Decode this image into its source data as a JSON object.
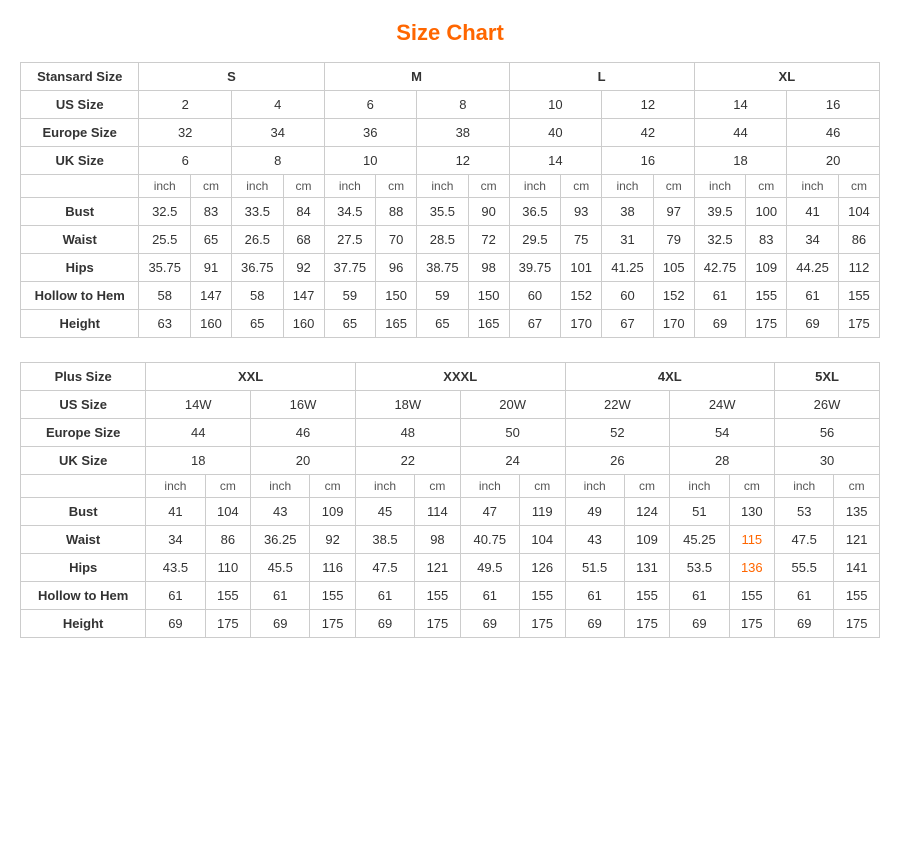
{
  "title": "Size Chart",
  "standard": {
    "headers": {
      "col1": "Stansard Size",
      "s": "S",
      "m": "M",
      "l": "L",
      "xl": "XL"
    },
    "us_size": {
      "label": "US Size",
      "values": [
        "2",
        "4",
        "6",
        "8",
        "10",
        "12",
        "14",
        "16"
      ]
    },
    "europe_size": {
      "label": "Europe Size",
      "values": [
        "32",
        "34",
        "36",
        "38",
        "40",
        "42",
        "44",
        "46"
      ]
    },
    "uk_size": {
      "label": "UK Size",
      "values": [
        "6",
        "8",
        "10",
        "12",
        "14",
        "16",
        "18",
        "20"
      ]
    },
    "subheader": [
      "inch",
      "cm",
      "inch",
      "cm",
      "inch",
      "cm",
      "inch",
      "cm",
      "inch",
      "cm",
      "inch",
      "cm",
      "inch",
      "cm",
      "inch",
      "cm"
    ],
    "bust": {
      "label": "Bust",
      "values": [
        "32.5",
        "83",
        "33.5",
        "84",
        "34.5",
        "88",
        "35.5",
        "90",
        "36.5",
        "93",
        "38",
        "97",
        "39.5",
        "100",
        "41",
        "104"
      ]
    },
    "waist": {
      "label": "Waist",
      "values": [
        "25.5",
        "65",
        "26.5",
        "68",
        "27.5",
        "70",
        "28.5",
        "72",
        "29.5",
        "75",
        "31",
        "79",
        "32.5",
        "83",
        "34",
        "86"
      ]
    },
    "hips": {
      "label": "Hips",
      "values": [
        "35.75",
        "91",
        "36.75",
        "92",
        "37.75",
        "96",
        "38.75",
        "98",
        "39.75",
        "101",
        "41.25",
        "105",
        "42.75",
        "109",
        "44.25",
        "112"
      ]
    },
    "hollow": {
      "label": "Hollow to Hem",
      "values": [
        "58",
        "147",
        "58",
        "147",
        "59",
        "150",
        "59",
        "150",
        "60",
        "152",
        "60",
        "152",
        "61",
        "155",
        "61",
        "155"
      ]
    },
    "height": {
      "label": "Height",
      "values": [
        "63",
        "160",
        "65",
        "160",
        "65",
        "165",
        "65",
        "165",
        "67",
        "170",
        "67",
        "170",
        "69",
        "175",
        "69",
        "175"
      ]
    }
  },
  "plus": {
    "headers": {
      "col1": "Plus Size",
      "xxl": "XXL",
      "xxxl": "XXXL",
      "x4l": "4XL",
      "x5l": "5XL"
    },
    "us_size": {
      "label": "US Size",
      "values": [
        "14W",
        "16W",
        "18W",
        "20W",
        "22W",
        "24W",
        "26W"
      ]
    },
    "europe_size": {
      "label": "Europe Size",
      "values": [
        "44",
        "46",
        "48",
        "50",
        "52",
        "54",
        "56"
      ]
    },
    "uk_size": {
      "label": "UK Size",
      "values": [
        "18",
        "20",
        "22",
        "24",
        "26",
        "28",
        "30"
      ]
    },
    "subheader": [
      "inch",
      "cm",
      "inch",
      "cm",
      "inch",
      "cm",
      "inch",
      "cm",
      "inch",
      "cm",
      "inch",
      "cm",
      "inch",
      "cm"
    ],
    "bust": {
      "label": "Bust",
      "values": [
        "41",
        "104",
        "43",
        "109",
        "45",
        "114",
        "47",
        "119",
        "49",
        "124",
        "51",
        "130",
        "53",
        "135"
      ]
    },
    "waist": {
      "label": "Waist",
      "values": [
        "34",
        "86",
        "36.25",
        "92",
        "38.5",
        "98",
        "40.75",
        "104",
        "43",
        "109",
        "45.25",
        "115",
        "47.5",
        "121"
      ]
    },
    "hips": {
      "label": "Hips",
      "values": [
        "43.5",
        "110",
        "45.5",
        "116",
        "47.5",
        "121",
        "49.5",
        "126",
        "51.5",
        "131",
        "53.5",
        "136",
        "55.5",
        "141"
      ]
    },
    "hollow": {
      "label": "Hollow to Hem",
      "values": [
        "61",
        "155",
        "61",
        "155",
        "61",
        "155",
        "61",
        "155",
        "61",
        "155",
        "61",
        "155",
        "61",
        "155"
      ]
    },
    "height": {
      "label": "Height",
      "values": [
        "69",
        "175",
        "69",
        "175",
        "69",
        "175",
        "69",
        "175",
        "69",
        "175",
        "69",
        "175",
        "69",
        "175"
      ]
    }
  }
}
